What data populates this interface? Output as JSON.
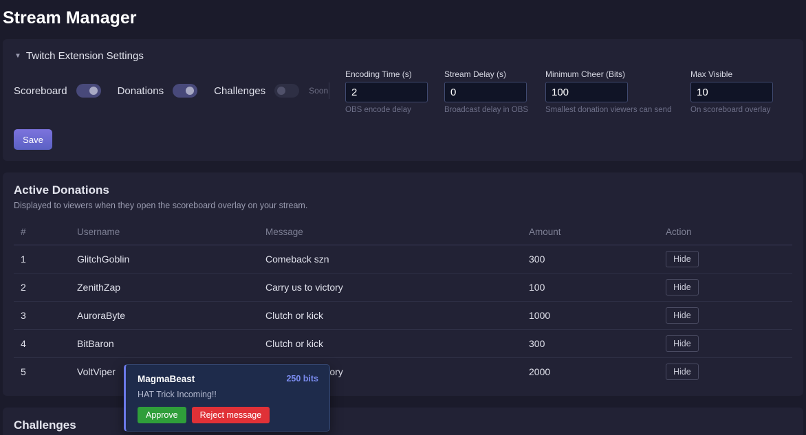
{
  "page": {
    "title": "Stream Manager"
  },
  "settings": {
    "summary": "Twitch Extension Settings",
    "toggles": [
      {
        "label": "Scoreboard",
        "on": true
      },
      {
        "label": "Donations",
        "on": true
      },
      {
        "label": "Challenges",
        "on": false,
        "badge": "Soon"
      }
    ],
    "fields": [
      {
        "label": "Encoding Time (s)",
        "value": "2",
        "help": "OBS encode delay"
      },
      {
        "label": "Stream Delay (s)",
        "value": "0",
        "help": "Broadcast delay in OBS"
      },
      {
        "label": "Minimum Cheer (Bits)",
        "value": "100",
        "help": "Smallest donation viewers can send"
      },
      {
        "label": "Max Visible",
        "value": "10",
        "help": "On scoreboard overlay"
      }
    ],
    "save_label": "Save"
  },
  "donations": {
    "title": "Active Donations",
    "description": "Displayed to viewers when they open the scoreboard overlay on your stream.",
    "columns": [
      "#",
      "Username",
      "Message",
      "Amount",
      "Action"
    ],
    "rows": [
      {
        "num": "1",
        "username": "GlitchGoblin",
        "message": "Comeback szn",
        "amount": "300",
        "action": "Hide"
      },
      {
        "num": "2",
        "username": "ZenithZap",
        "message": "Carry us to victory",
        "amount": "100",
        "action": "Hide"
      },
      {
        "num": "3",
        "username": "AuroraByte",
        "message": "Clutch or kick",
        "amount": "1000",
        "action": "Hide"
      },
      {
        "num": "4",
        "username": "BitBaron",
        "message": "Clutch or kick",
        "amount": "300",
        "action": "Hide"
      },
      {
        "num": "5",
        "username": "VoltViper",
        "message": "Carry us to victory",
        "amount": "2000",
        "action": "Hide"
      }
    ]
  },
  "challenges": {
    "title": "Challenges"
  },
  "popup": {
    "username": "MagmaBeast",
    "bits": "250 bits",
    "message": "HAT Trick Incoming!!",
    "approve_label": "Approve",
    "reject_label": "Reject message"
  },
  "colors": {
    "background": "#1b1b2b",
    "card": "#222235",
    "accent": "#6b79e8",
    "approve": "#2f9e3a",
    "reject": "#e03137"
  }
}
